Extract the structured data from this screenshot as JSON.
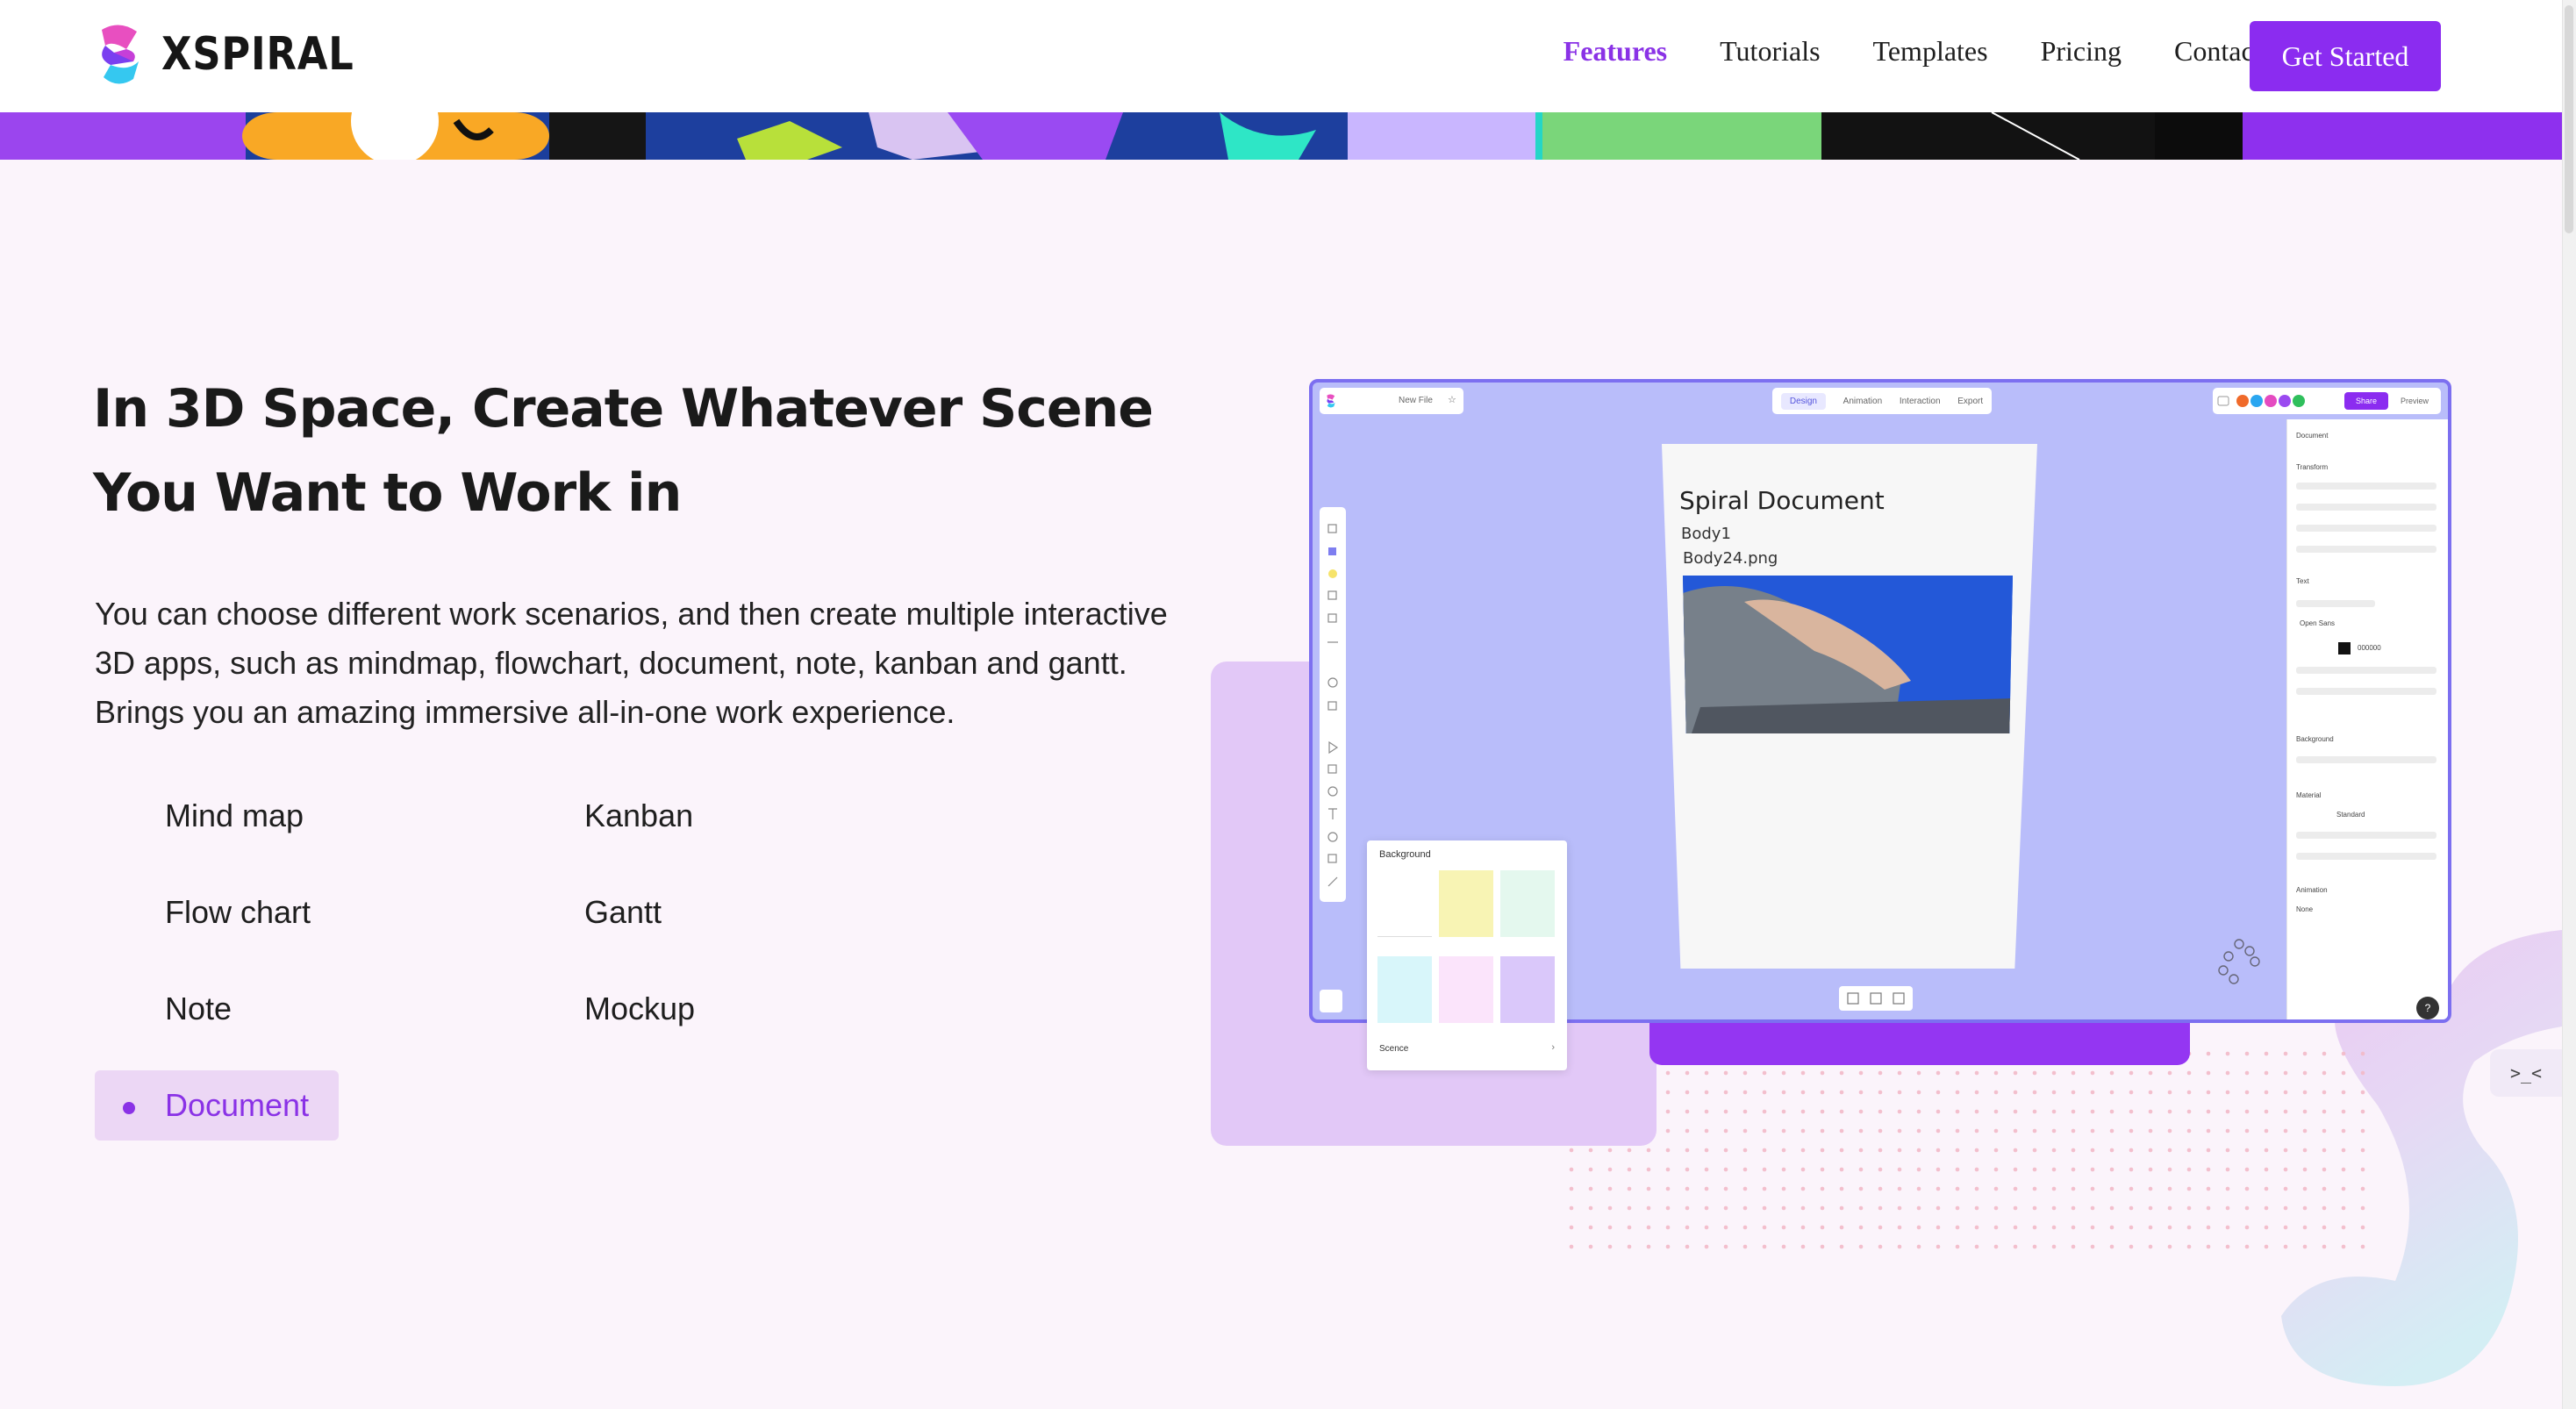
{
  "header": {
    "brand": "XSPIRAL",
    "nav": [
      {
        "label": "Features",
        "active": true
      },
      {
        "label": "Tutorials",
        "active": false
      },
      {
        "label": "Templates",
        "active": false
      },
      {
        "label": "Pricing",
        "active": false
      },
      {
        "label": "Contacts",
        "active": false
      }
    ],
    "cta_label": "Get Started"
  },
  "hero": {
    "headline_line1": "In 3D Space, Create Whatever Scene",
    "headline_line2": "You Want to Work in",
    "description": "You can choose different work scenarios, and then create multiple interactive 3D apps, such as mindmap, flowchart, document, note, kanban and gantt. Brings you an amazing immersive all-in-one work experience.",
    "features": [
      {
        "label": "Mind map",
        "active": false
      },
      {
        "label": "Kanban",
        "active": false
      },
      {
        "label": "Flow chart",
        "active": false
      },
      {
        "label": "Gantt",
        "active": false
      },
      {
        "label": "Note",
        "active": false
      },
      {
        "label": "Mockup",
        "active": false
      },
      {
        "label": "Document",
        "active": true
      }
    ]
  },
  "app_preview": {
    "file_label": "New File",
    "tabs": [
      "Design",
      "Animation",
      "Interaction",
      "Export"
    ],
    "selected_tab": "Design",
    "share_label": "Share",
    "preview_label": "Preview",
    "doc_title": "Spiral Document",
    "doc_body": "Body1",
    "doc_file": "Body24.png",
    "panel": {
      "document": "Document",
      "transform": "Transform",
      "text": "Text",
      "background": "Background",
      "material": "Material",
      "animation": "Animation",
      "animation_value": "None",
      "material_value": "Standard",
      "font_value": "Open Sans",
      "color_value": "000000"
    },
    "background_popup": {
      "title": "Background",
      "swatches": [
        "#ffffff",
        "#f8f4b4",
        "#e4f8ee",
        "#d8f6fa",
        "#fbe4fb",
        "#dac8fa"
      ],
      "scene_label": "Scence"
    }
  },
  "colors": {
    "accent": "#8B2CF0",
    "page_bg": "#FBF4FB",
    "canvas_bg": "#B9BDFA"
  },
  "collapse_tab_label": ">_<"
}
